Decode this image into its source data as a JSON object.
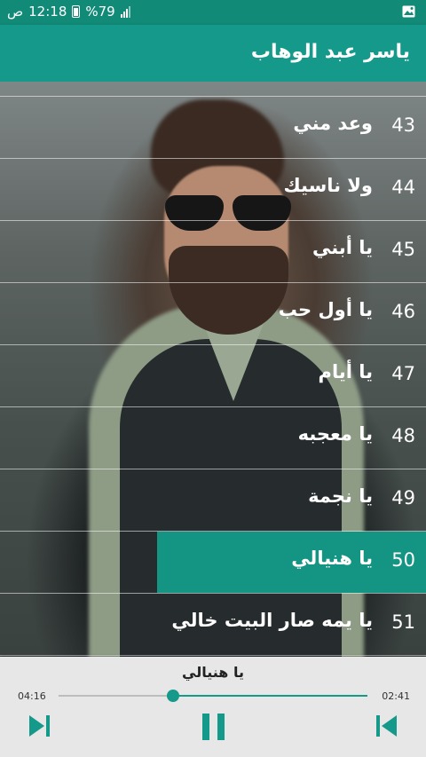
{
  "status_bar": {
    "time": "12:18",
    "period": "ص",
    "battery": "%79",
    "signal_icon": "signal-icon",
    "battery_icon": "battery-icon",
    "gallery_icon": "image-icon"
  },
  "app_bar": {
    "title": "ياسر عبد الوهاب"
  },
  "songs": [
    {
      "number": "43",
      "title": "وعد مني"
    },
    {
      "number": "44",
      "title": "ولا ناسيك"
    },
    {
      "number": "45",
      "title": "يا أبني"
    },
    {
      "number": "46",
      "title": "يا أول حب"
    },
    {
      "number": "47",
      "title": "يا أيام"
    },
    {
      "number": "48",
      "title": "يا معجبه"
    },
    {
      "number": "49",
      "title": "يا نجمة"
    },
    {
      "number": "50",
      "title": "يا هنيالي",
      "active": true
    },
    {
      "number": "51",
      "title": "يا يمه صار البيت خالي"
    }
  ],
  "player": {
    "now_playing": "يا هنيالي",
    "elapsed": "02:41",
    "duration": "04:16",
    "progress": 0.63,
    "accent_color": "#14998a",
    "next_icon": "skip-next-icon",
    "pause_icon": "pause-icon",
    "previous_icon": "skip-previous-icon"
  }
}
